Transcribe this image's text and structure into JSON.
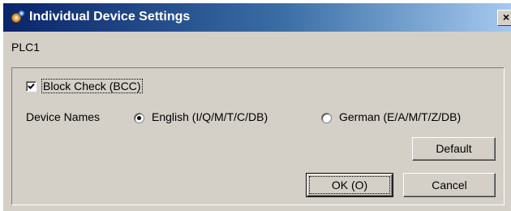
{
  "window": {
    "title": "Individual Device Settings",
    "close_glyph": "×",
    "icon": "settings-gear-icon"
  },
  "device": {
    "name": "PLC1"
  },
  "options": {
    "block_check_label": "Block Check (BCC)",
    "block_check_checked": true,
    "device_names_label": "Device Names",
    "device_names_options": [
      {
        "label": "English (I/Q/M/T/C/DB)",
        "selected": true
      },
      {
        "label": "German (E/A/M/T/Z/DB)",
        "selected": false
      }
    ]
  },
  "buttons": {
    "default_label": "Default",
    "ok_label": "OK (O)",
    "cancel_label": "Cancel"
  }
}
